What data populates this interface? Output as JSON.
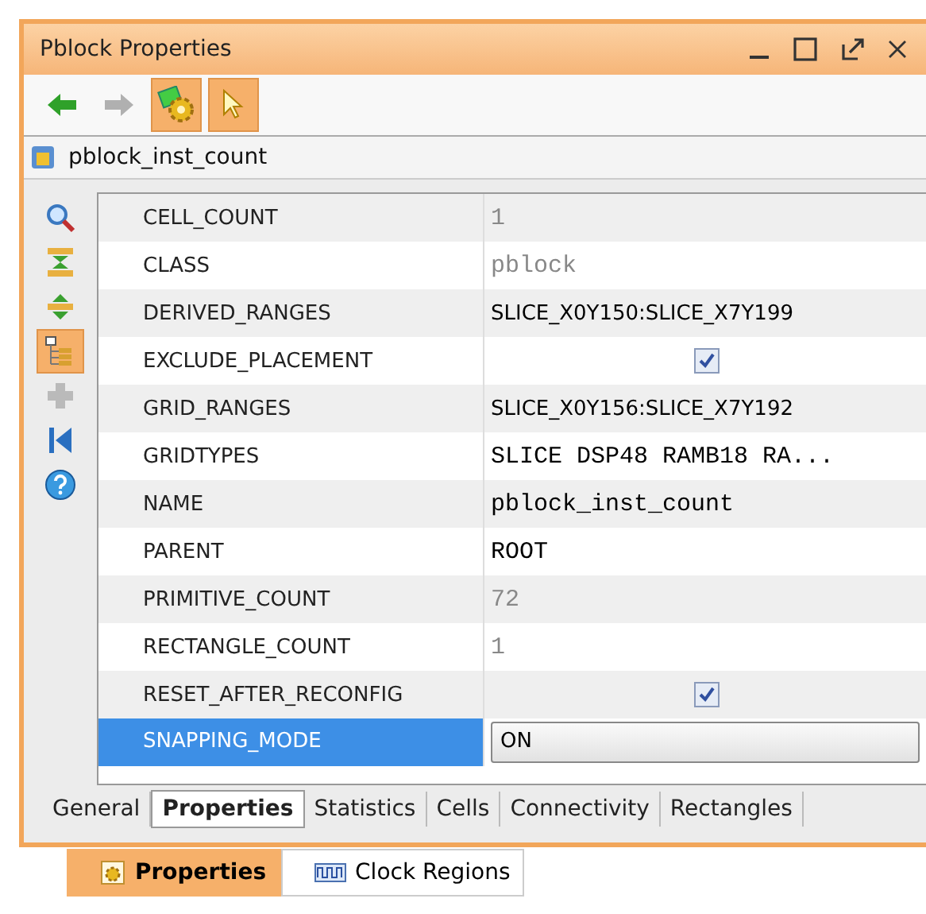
{
  "window": {
    "title": "Pblock Properties"
  },
  "toolbar": [
    {
      "kind": "back",
      "disabled": false,
      "on": false
    },
    {
      "kind": "forward",
      "disabled": true,
      "on": false
    },
    {
      "kind": "gear",
      "disabled": false,
      "on": true
    },
    {
      "kind": "pointer",
      "disabled": false,
      "on": true
    }
  ],
  "object": {
    "name": "pblock_inst_count"
  },
  "side_tools": [
    {
      "kind": "search",
      "disabled": false,
      "on": false
    },
    {
      "kind": "collapse",
      "disabled": false,
      "on": false
    },
    {
      "kind": "expand",
      "disabled": false,
      "on": false
    },
    {
      "kind": "tree",
      "disabled": false,
      "on": true
    },
    {
      "kind": "add",
      "disabled": true,
      "on": false
    },
    {
      "kind": "first",
      "disabled": false,
      "on": false
    },
    {
      "kind": "help",
      "disabled": false,
      "on": false
    }
  ],
  "properties": [
    {
      "name": "CELL_COUNT",
      "kind": "code",
      "value": "1",
      "disabled": true,
      "selected": false
    },
    {
      "name": "CLASS",
      "kind": "code",
      "value": "pblock",
      "disabled": true,
      "selected": false
    },
    {
      "name": "DERIVED_RANGES",
      "kind": "text",
      "value": "SLICE_X0Y150:SLICE_X7Y199",
      "disabled": false,
      "selected": false
    },
    {
      "name": "EXCLUDE_PLACEMENT",
      "kind": "checkbox",
      "checked": true,
      "selected": false
    },
    {
      "name": "GRID_RANGES",
      "kind": "text",
      "value": "SLICE_X0Y156:SLICE_X7Y192",
      "disabled": false,
      "selected": false
    },
    {
      "name": "GRIDTYPES",
      "kind": "code",
      "value": "SLICE DSP48 RAMB18 RA...",
      "disabled": false,
      "selected": false
    },
    {
      "name": "NAME",
      "kind": "code",
      "value": "pblock_inst_count",
      "disabled": false,
      "selected": false
    },
    {
      "name": "PARENT",
      "kind": "code",
      "value": "ROOT",
      "disabled": false,
      "selected": false
    },
    {
      "name": "PRIMITIVE_COUNT",
      "kind": "code",
      "value": "72",
      "disabled": true,
      "selected": false
    },
    {
      "name": "RECTANGLE_COUNT",
      "kind": "code",
      "value": "1",
      "disabled": true,
      "selected": false
    },
    {
      "name": "RESET_AFTER_RECONFIG",
      "kind": "checkbox",
      "checked": true,
      "selected": false
    },
    {
      "name": "SNAPPING_MODE",
      "kind": "combo",
      "value": "ON",
      "selected": true
    }
  ],
  "tabs": [
    {
      "label": "General",
      "selected": false
    },
    {
      "label": "Properties",
      "selected": true
    },
    {
      "label": "Statistics",
      "selected": false
    },
    {
      "label": "Cells",
      "selected": false
    },
    {
      "label": "Connectivity",
      "selected": false
    },
    {
      "label": "Rectangles",
      "selected": false
    }
  ],
  "dock_tabs": [
    {
      "label": "Properties",
      "kind": "properties",
      "selected": true
    },
    {
      "label": "Clock Regions",
      "kind": "clock",
      "selected": false
    }
  ]
}
